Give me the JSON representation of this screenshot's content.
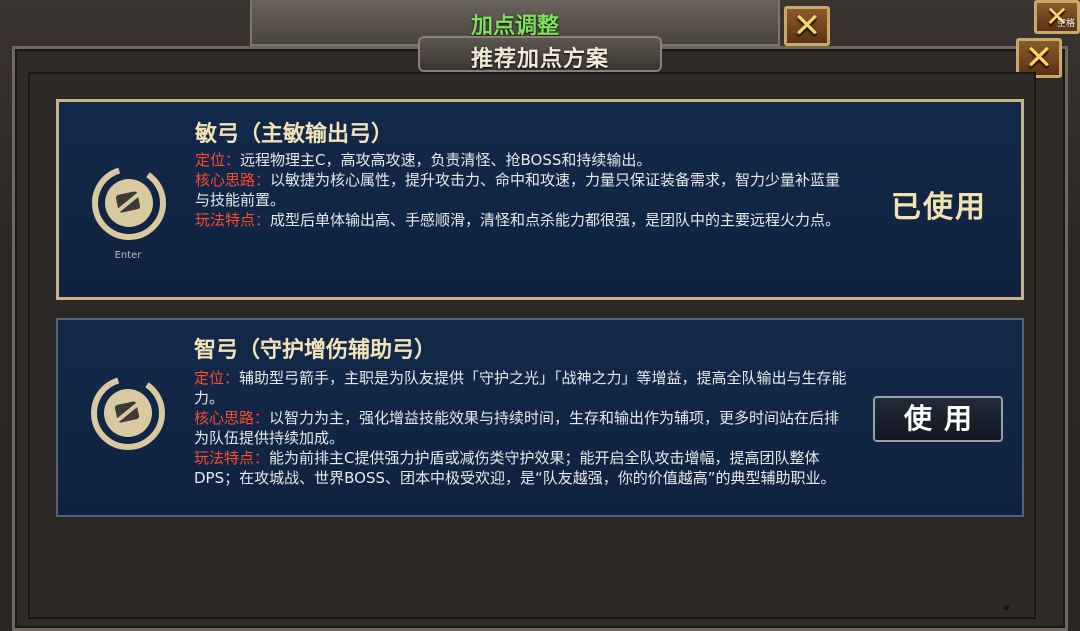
{
  "background_window": {
    "title": "加点调整",
    "close_glyph": "✕",
    "far_close_label": "空格"
  },
  "dialog": {
    "title": "推荐加点方案",
    "close_glyph": "✕"
  },
  "plans": [
    {
      "title": "敏弓（主敏输出弓）",
      "icon": "bow-emblem-icon",
      "emblem_label": "Enter",
      "status": "已使用",
      "lines": [
        {
          "label": "定位：",
          "text": "远程物理主C，高攻高攻速，负责清怪、抢BOSS和持续输出。"
        },
        {
          "label": "核心思路：",
          "text": "以敏捷为核心属性，提升攻击力、命中和攻速，力量只保证装备需求，智力少量补蓝量与技能前置。"
        },
        {
          "label": "玩法特点：",
          "text": "成型后单体输出高、手感顺滑，清怪和点杀能力都很强，是团队中的主要远程火力点。"
        }
      ]
    },
    {
      "title": "智弓（守护增伤辅助弓）",
      "icon": "bow-emblem-icon",
      "button_label": "使用",
      "lines": [
        {
          "label": "定位：",
          "text": "辅助型弓箭手，主职是为队友提供「守护之光」「战神之力」等增益，提高全队输出与生存能力。"
        },
        {
          "label": "核心思路：",
          "text": "以智力为主，强化增益技能效果与持续时间，生存和输出作为辅项，更多时间站在后排为队伍提供持续加成。"
        },
        {
          "label": "玩法特点：",
          "text": "能为前排主C提供强力护盾或减伤类守护效果；能开启全队攻击增幅，提高团队整体DPS；在攻城战、世界BOSS、团本中极受欢迎，是“队友越强，你的价值越高”的典型辅助职业。"
        }
      ]
    }
  ],
  "colors": {
    "label_red": "#ff4b2b",
    "card_blue": "#13294a",
    "gold_border": "#c8b585",
    "title_green": "#7ee05b"
  }
}
